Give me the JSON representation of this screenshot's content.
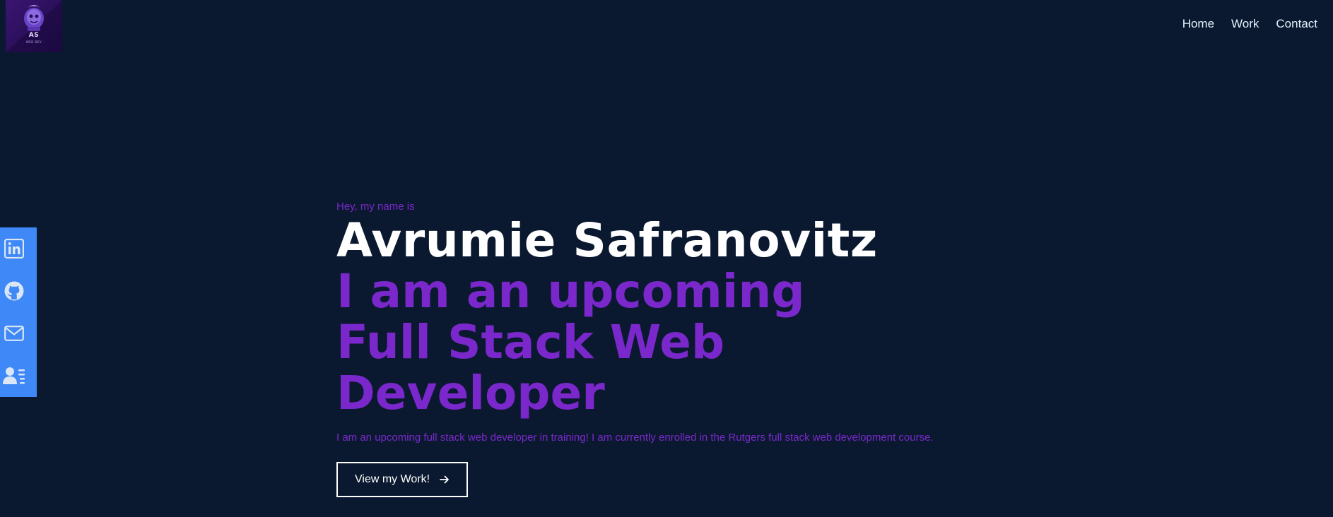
{
  "logo": {
    "initials": "AS",
    "subtext": "WEB DEV"
  },
  "nav": {
    "items": [
      {
        "label": "Home"
      },
      {
        "label": "Work"
      },
      {
        "label": "Contact"
      }
    ]
  },
  "social": {
    "background_color": "#3e88f7",
    "links": [
      {
        "icon": "linkedin-icon"
      },
      {
        "icon": "github-icon"
      },
      {
        "icon": "mail-icon"
      },
      {
        "icon": "contact-card-icon"
      }
    ]
  },
  "hero": {
    "greeting": "Hey, my name is",
    "name": "Avrumie Safranovitz",
    "tagline": "I am an upcoming Full Stack Web Developer",
    "description": "I am an upcoming full stack web developer in training! I am currently enrolled in the Rutgers full stack web development course.",
    "cta_label": "View my Work!"
  },
  "colors": {
    "background": "#0a192f",
    "accent": "#7a28cb",
    "text": "#ffffff"
  }
}
